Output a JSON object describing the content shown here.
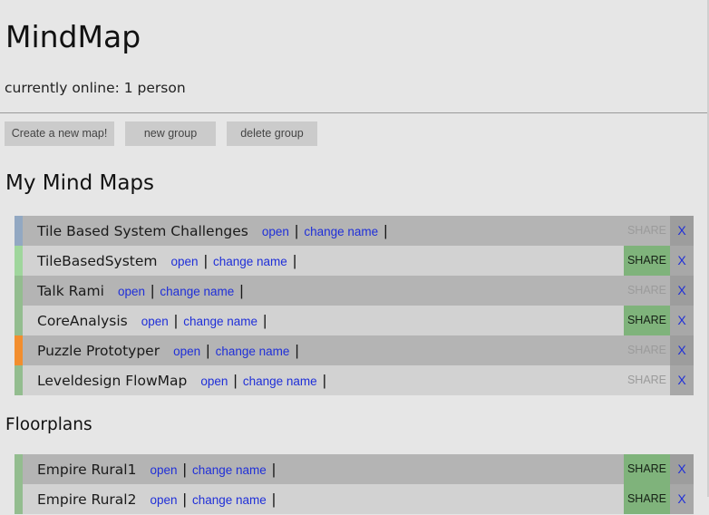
{
  "header": {
    "title": "MindMap",
    "online_status": "currently online: 1 person"
  },
  "toolbar": {
    "create_label": "Create a new map!",
    "new_group_label": "new group",
    "delete_group_label": "delete group"
  },
  "row_actions": {
    "open_label": "open",
    "rename_label": "change name",
    "separator": "|",
    "share_label": "SHARE",
    "delete_label": "X"
  },
  "groups": [
    {
      "heading": "My Mind Maps",
      "maps": [
        {
          "name": "Tile Based System Challenges",
          "color": "#92a8c2",
          "shared": false
        },
        {
          "name": "TileBasedSystem",
          "color": "#9fd69c",
          "shared": true
        },
        {
          "name": "Talk Rami",
          "color": "#93bd8f",
          "shared": false
        },
        {
          "name": "CoreAnalysis",
          "color": "#93bd8f",
          "shared": true
        },
        {
          "name": "Puzzle Prototyper",
          "color": "#f28e2e",
          "shared": false
        },
        {
          "name": "Leveldesign FlowMap",
          "color": "#93bd8f",
          "shared": false
        }
      ]
    },
    {
      "heading": "Floorplans",
      "maps": [
        {
          "name": "Empire Rural1",
          "color": "#93bd8f",
          "shared": true
        },
        {
          "name": "Empire Rural2",
          "color": "#93bd8f",
          "shared": true
        }
      ]
    }
  ],
  "colors": {
    "shared_button": "#7fb37b",
    "link": "#1f2fd8",
    "row_dark": "#b4b4b4",
    "row_light": "#d2d2d2"
  }
}
